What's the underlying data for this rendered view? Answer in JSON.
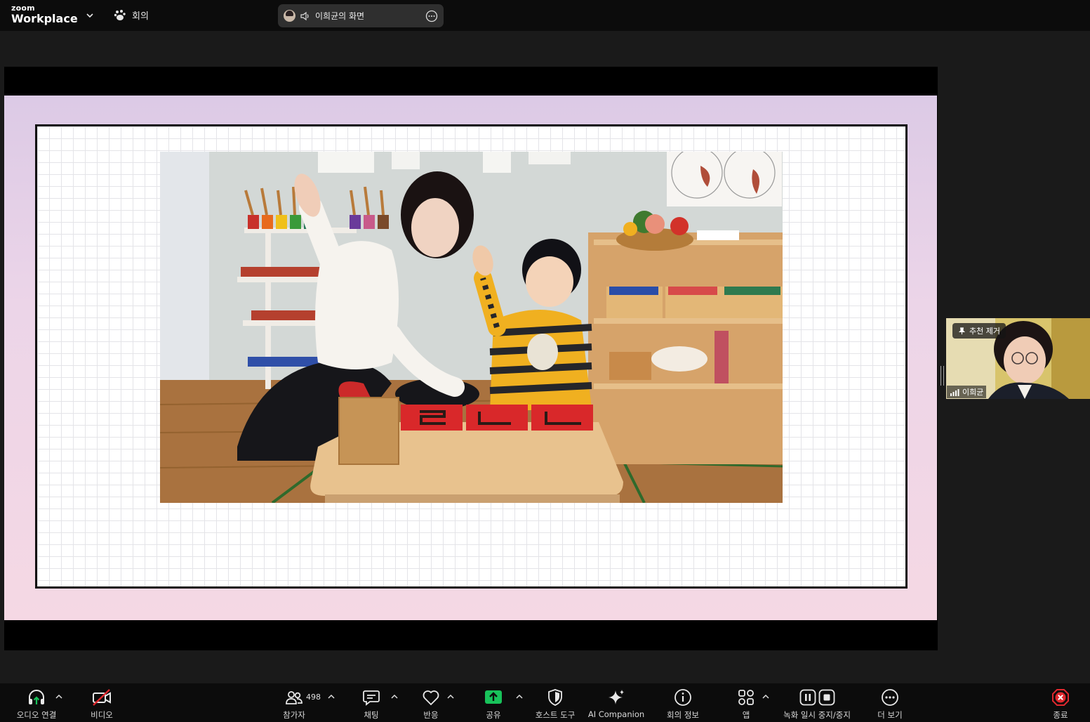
{
  "topbar": {
    "brand_small": "zoom",
    "brand_big": "Workplace",
    "meeting_label": "회의",
    "share_title": "이희균의 화면"
  },
  "participant": {
    "spotlight_label": "추천 제거",
    "name": "이희균"
  },
  "toolbar": {
    "audio": "오디오 연결",
    "video": "비디오",
    "participants": "참가자",
    "participant_count": "498",
    "chat": "채팅",
    "reactions": "반응",
    "share": "공유",
    "host_tools": "호스트 도구",
    "ai_companion": "AI Companion",
    "meeting_info": "회의 정보",
    "apps": "앱",
    "recording": "녹화 일시 중지/중지",
    "more": "더 보기",
    "end": "종료"
  },
  "colors": {
    "share_accent": "#18c25a",
    "end_red": "#e0282e",
    "video_off_red": "#e0282e"
  },
  "icons": [
    "zoom-chevron-icon",
    "meeting-paw-icon",
    "speaker-icon",
    "more-circle-icon",
    "pin-icon",
    "signal-icon",
    "headphones-icon",
    "video-off-icon",
    "participants-icon",
    "chat-icon",
    "heart-icon",
    "share-arrow-icon",
    "shield-icon",
    "sparkle-icon",
    "info-icon",
    "apps-icon",
    "pause-icon",
    "stop-icon",
    "more-dots-icon",
    "end-x-icon"
  ]
}
